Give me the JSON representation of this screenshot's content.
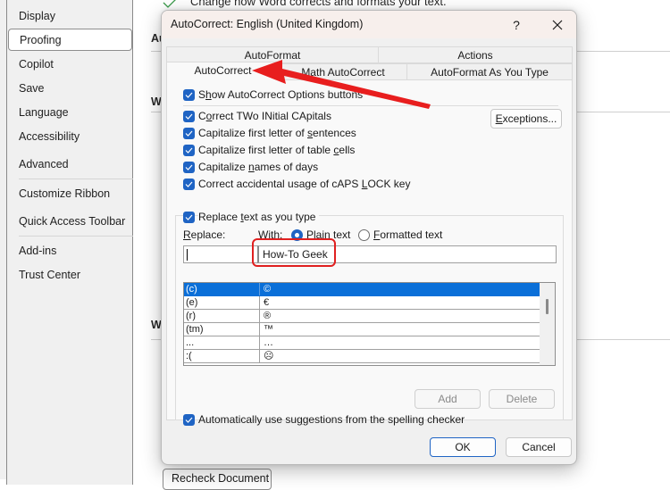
{
  "options_window": {
    "sidebar": {
      "items": [
        {
          "label": "Display",
          "active": false
        },
        {
          "label": "Proofing",
          "active": true
        },
        {
          "label": "Copilot",
          "active": false
        },
        {
          "label": "Save",
          "active": false
        },
        {
          "label": "Language",
          "active": false
        },
        {
          "label": "Accessibility",
          "active": false
        },
        {
          "label": "Advanced",
          "active": false
        },
        {
          "label": "Customize Ribbon",
          "active": false
        },
        {
          "label": "Quick Access Toolbar",
          "active": false
        },
        {
          "label": "Add-ins",
          "active": false
        },
        {
          "label": "Trust Center",
          "active": false
        }
      ]
    },
    "main": {
      "description": "Change how Word corrects and formats your text.",
      "section_heading_1": "Au",
      "section_heading_2": "W",
      "section_heading_3": "W",
      "recheck_button": "Recheck Document"
    }
  },
  "dialog": {
    "title": "AutoCorrect: English (United Kingdom)",
    "help_label": "?",
    "tabs_row1": [
      {
        "label": "AutoFormat"
      },
      {
        "label": "Actions"
      }
    ],
    "tabs_row2": [
      {
        "label": "AutoCorrect",
        "active": true
      },
      {
        "label": "Math AutoCorrect",
        "active": false
      },
      {
        "label": "AutoFormat As You Type",
        "active": false
      }
    ],
    "show_options": {
      "pre": "S",
      "u": "h",
      "post": "ow AutoCorrect Options buttons",
      "checked": true
    },
    "options": [
      {
        "pre": "C",
        "u": "o",
        "post": "rrect TWo INitial CApitals",
        "checked": true
      },
      {
        "pre": "Capitalize first letter of ",
        "u": "s",
        "post": "entences",
        "checked": true
      },
      {
        "pre": "Capitalize first letter of table ",
        "u": "c",
        "post": "ells",
        "checked": true
      },
      {
        "pre": "Capitalize ",
        "u": "n",
        "post": "ames of days",
        "checked": true
      },
      {
        "pre": "Correct accidental usage of cAPS ",
        "u": "L",
        "post": "OCK key",
        "checked": true
      }
    ],
    "exceptions_button": {
      "u": "E",
      "post": "xceptions..."
    },
    "replace_text": {
      "pre": "Replace ",
      "u": "t",
      "post": "ext as you type",
      "checked": true
    },
    "replace_label": {
      "u": "R",
      "post": "eplace:"
    },
    "with_label": "With:",
    "plain_text": {
      "u": "P",
      "post": "lain text",
      "selected": true
    },
    "formatted_text": {
      "u": "F",
      "post": "ormatted text",
      "selected": false
    },
    "replace_value": "",
    "with_value": "How-To Geek",
    "entries": [
      {
        "replace": "(c)",
        "with": "©",
        "selected": true
      },
      {
        "replace": "(e)",
        "with": "€",
        "selected": false
      },
      {
        "replace": "(r)",
        "with": "®",
        "selected": false
      },
      {
        "replace": "(tm)",
        "with": "™",
        "selected": false
      },
      {
        "replace": "...",
        "with": "…",
        "selected": false
      },
      {
        "replace": ":(",
        "with": "☹",
        "selected": false
      }
    ],
    "add_button": "Add",
    "delete_button": "Delete",
    "auto_suggest": {
      "pre": "Automatically use su",
      "u": "g",
      "post": "gestions from the spelling checker",
      "checked": true
    },
    "ok_button": "OK",
    "cancel_button": "Cancel"
  },
  "annotation": {
    "arrow_color": "#e81e1e",
    "highlight_color": "#e02020"
  }
}
